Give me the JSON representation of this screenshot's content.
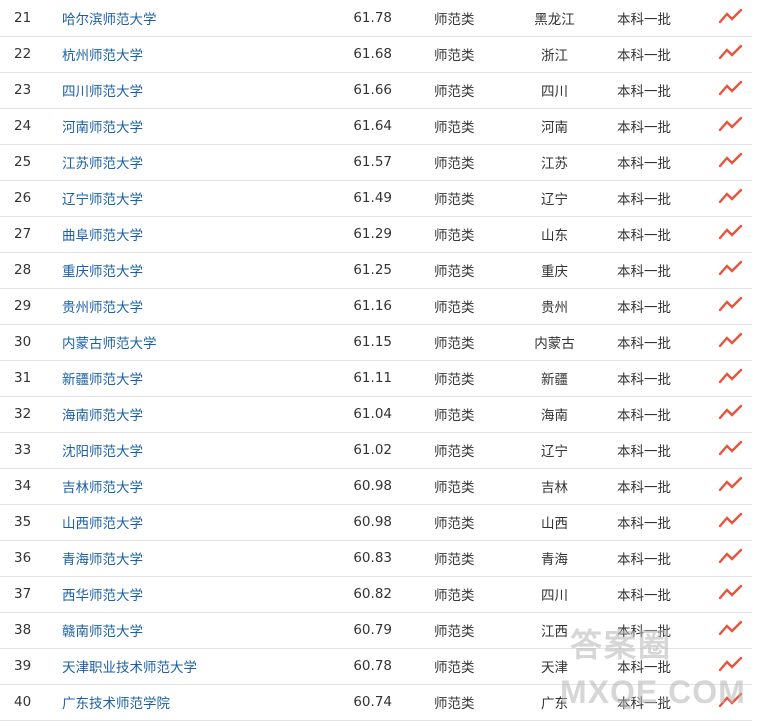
{
  "rows": [
    {
      "rank": "21",
      "name": "哈尔滨师范大学",
      "score": "61.78",
      "type": "师范类",
      "province": "黑龙江",
      "batch": "本科一批"
    },
    {
      "rank": "22",
      "name": "杭州师范大学",
      "score": "61.68",
      "type": "师范类",
      "province": "浙江",
      "batch": "本科一批"
    },
    {
      "rank": "23",
      "name": "四川师范大学",
      "score": "61.66",
      "type": "师范类",
      "province": "四川",
      "batch": "本科一批"
    },
    {
      "rank": "24",
      "name": "河南师范大学",
      "score": "61.64",
      "type": "师范类",
      "province": "河南",
      "batch": "本科一批"
    },
    {
      "rank": "25",
      "name": "江苏师范大学",
      "score": "61.57",
      "type": "师范类",
      "province": "江苏",
      "batch": "本科一批"
    },
    {
      "rank": "26",
      "name": "辽宁师范大学",
      "score": "61.49",
      "type": "师范类",
      "province": "辽宁",
      "batch": "本科一批"
    },
    {
      "rank": "27",
      "name": "曲阜师范大学",
      "score": "61.29",
      "type": "师范类",
      "province": "山东",
      "batch": "本科一批"
    },
    {
      "rank": "28",
      "name": "重庆师范大学",
      "score": "61.25",
      "type": "师范类",
      "province": "重庆",
      "batch": "本科一批"
    },
    {
      "rank": "29",
      "name": "贵州师范大学",
      "score": "61.16",
      "type": "师范类",
      "province": "贵州",
      "batch": "本科一批"
    },
    {
      "rank": "30",
      "name": "内蒙古师范大学",
      "score": "61.15",
      "type": "师范类",
      "province": "内蒙古",
      "batch": "本科一批"
    },
    {
      "rank": "31",
      "name": "新疆师范大学",
      "score": "61.11",
      "type": "师范类",
      "province": "新疆",
      "batch": "本科一批"
    },
    {
      "rank": "32",
      "name": "海南师范大学",
      "score": "61.04",
      "type": "师范类",
      "province": "海南",
      "batch": "本科一批"
    },
    {
      "rank": "33",
      "name": "沈阳师范大学",
      "score": "61.02",
      "type": "师范类",
      "province": "辽宁",
      "batch": "本科一批"
    },
    {
      "rank": "34",
      "name": "吉林师范大学",
      "score": "60.98",
      "type": "师范类",
      "province": "吉林",
      "batch": "本科一批"
    },
    {
      "rank": "35",
      "name": "山西师范大学",
      "score": "60.98",
      "type": "师范类",
      "province": "山西",
      "batch": "本科一批"
    },
    {
      "rank": "36",
      "name": "青海师范大学",
      "score": "60.83",
      "type": "师范类",
      "province": "青海",
      "batch": "本科一批"
    },
    {
      "rank": "37",
      "name": "西华师范大学",
      "score": "60.82",
      "type": "师范类",
      "province": "四川",
      "batch": "本科一批"
    },
    {
      "rank": "38",
      "name": "赣南师范大学",
      "score": "60.79",
      "type": "师范类",
      "province": "江西",
      "batch": "本科一批"
    },
    {
      "rank": "39",
      "name": "天津职业技术师范大学",
      "score": "60.78",
      "type": "师范类",
      "province": "天津",
      "batch": "本科一批"
    },
    {
      "rank": "40",
      "name": "广东技术师范学院",
      "score": "60.74",
      "type": "师范类",
      "province": "广东",
      "batch": "本科一批"
    }
  ],
  "trend_icon": "trend-up-icon",
  "colors": {
    "link": "#1a5fa8",
    "trend": "#e8553e",
    "border": "#e3e3e3"
  },
  "watermark": {
    "top": "答案圈",
    "bottom": "MXQE.COM"
  }
}
